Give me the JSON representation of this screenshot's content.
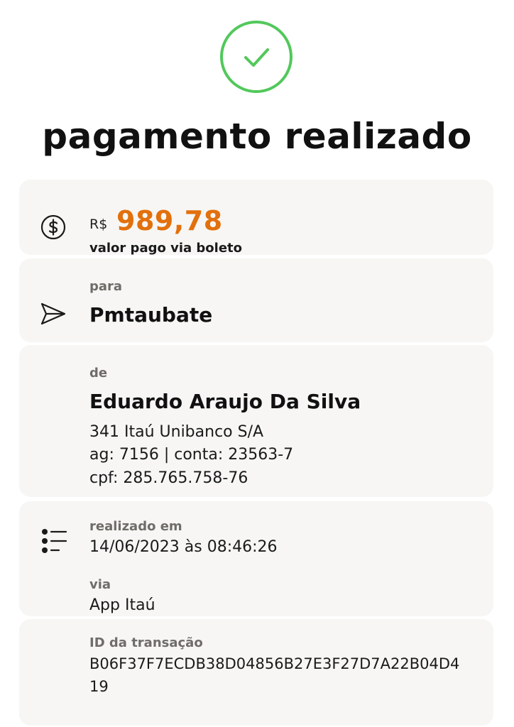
{
  "header": {
    "title": "pagamento realizado",
    "status_icon": "check-circle-icon",
    "status_color": "#52c85b"
  },
  "amount": {
    "currency": "R$",
    "value": "989,78",
    "caption": "valor pago via boleto",
    "icon": "dollar-circle-icon",
    "accent_color": "#e2700c"
  },
  "recipient": {
    "label": "para",
    "name": "Pmtaubate",
    "icon": "send-icon"
  },
  "payer": {
    "label": "de",
    "name": "Eduardo Araujo Da Silva",
    "bank": "341 Itaú Unibanco S/A",
    "account": "ag: 7156 | conta: 23563-7",
    "cpf": "cpf: 285.765.758-76"
  },
  "details": {
    "icon": "list-icon",
    "date_label": "realizado em",
    "date_value": "14/06/2023 às 08:46:26",
    "channel_label": "via",
    "channel_value": "App Itaú"
  },
  "transaction": {
    "id_label": "ID da transação",
    "id_line1": "B06F37F7ECDB38D04856B27E3F27D7A22B04D4",
    "id_line2": "19"
  }
}
